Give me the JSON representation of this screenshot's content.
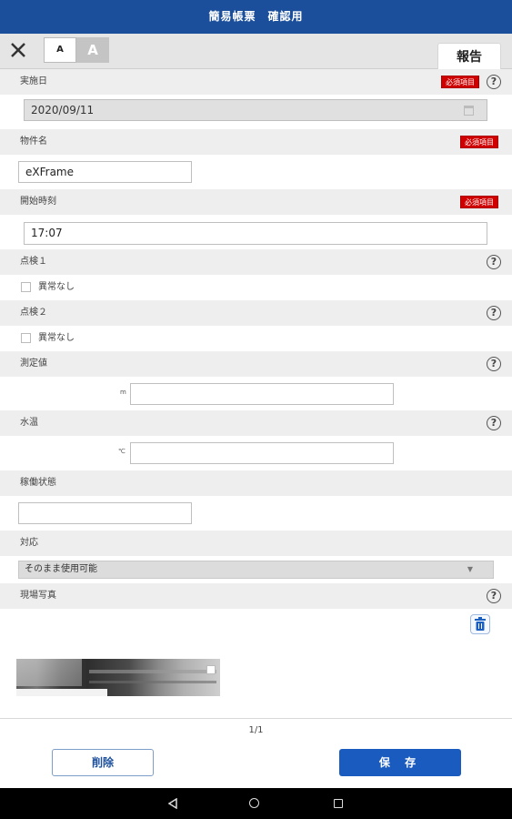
{
  "header": {
    "title": "簡易帳票　確認用"
  },
  "toolbar": {
    "font_small": "A",
    "font_large": "A",
    "tab_report": "報告"
  },
  "required_label": "必須項目",
  "help_symbol": "?",
  "fields": {
    "inspection_date": {
      "label": "実施日",
      "value": "2020/09/11"
    },
    "property_name": {
      "label": "物件名",
      "value": "eXFrame"
    },
    "start_time": {
      "label": "開始時刻",
      "value": "17:07"
    },
    "check1": {
      "label": "点検１",
      "option": "異常なし"
    },
    "check2": {
      "label": "点検２",
      "option": "異常なし"
    },
    "measurement": {
      "label": "測定値",
      "unit": "m",
      "value": ""
    },
    "water_temp": {
      "label": "水温",
      "unit": "℃",
      "value": ""
    },
    "operation_status": {
      "label": "稼働状態",
      "value": ""
    },
    "response": {
      "label": "対応",
      "selected": "そのまま使用可能"
    },
    "site_photo": {
      "label": "現場写真"
    }
  },
  "pager": {
    "text": "1/1"
  },
  "actions": {
    "delete_label": "削除",
    "save_label": "保 存"
  }
}
